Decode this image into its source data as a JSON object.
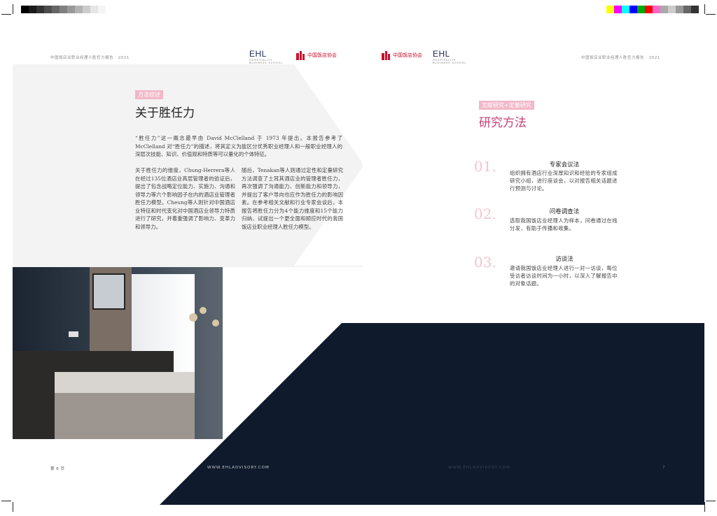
{
  "header": {
    "left_title": "中国饭店业职业经理人胜任力报告 · 2021",
    "right_title": "中国饭店业职业经理人胜任力报告 · 2021",
    "ehl_logo": "EHL",
    "ehl_sub": "HOSPITALITY BUSINESS SCHOOL",
    "association_logo": "中国饭店协会"
  },
  "left_page": {
    "tag": "方法综述",
    "title": "关于胜任力",
    "intro": "“胜任力”这一概念最早由 David McClelland 于 1973 年提出。本报告参考了 McClelland 对“胜任力”的描述，将其定义为能区分优秀职业经理人和一般职业经理人的深层次技能、知识、价值观和特质等可以量化的个体特征。",
    "col1": "关于胜任力的维度，Chung-Herrera等人在经过135位酒店业高层管理者的验证后，提出了包含战略定位能力、实施力、沟通和领导力等六个影响因子在内的酒店业管理者胜任力模型。Cheung等人则针对中国酒店业特征和时代变化对中国酒店业领导力特质进行了研究，并着重强调了影响力、变革力和领导力。",
    "col2": "随后，Tenakan等人则通过定性和定量研究方法调查了土耳其酒店业的管理者胜任力，再次强调了沟通能力、创新能力和领导力，并提出了客户导向也应作为胜任力的影响因素。在参考相关文献和行业专家会谈后，本报告将胜任力分为4个能力维度和15个能力归纳，试提出一个更全面和顺应时代的我国饭店业职业经理人胜任力模型。",
    "page_number": "第 6 页"
  },
  "right_page": {
    "tag": "文献研究+定量研究",
    "title": "研究方法",
    "methods": [
      {
        "number": "01.",
        "title": "专家会议法",
        "desc": "组织拥有酒店行业深厚知识和经验的专家组成研究小组，进行座谈会，以对报告相关话题进行预测与讨论。"
      },
      {
        "number": "02.",
        "title": "问卷调查法",
        "desc": "选取我国饭店业经理人为样本，问卷通过在线分发，有助于传播和收集。"
      },
      {
        "number": "03.",
        "title": "访谈法",
        "desc": "邀请我国饭店业经理人进行一对一访谈，每位受访者访谈时间为一小时，以深入了解报告中的对象话题。"
      }
    ],
    "page_number": "7"
  },
  "footer": {
    "left_url": "WWW.EHLADVISORY.COM",
    "right_url": "WWW.EHLADVISORY.COM"
  },
  "colors": {
    "navy": "#0f1b2d",
    "pink": "#f2b8c8",
    "accent_pink": "#c8427a",
    "light_gray": "#f3f3f4"
  },
  "color_bars": {
    "left": [
      "#000000",
      "#1a1a1a",
      "#333333",
      "#4d4d4d",
      "#666666",
      "#808080",
      "#999999",
      "#b3b3b3",
      "#cccccc",
      "#e6e6e6",
      "#f5f5f5"
    ],
    "right": [
      "#ffff00",
      "#ff00ff",
      "#00ffff",
      "#0000ff",
      "#00aa00",
      "#ff0000",
      "#ff66cc",
      "#aaaaaa",
      "#cccccc",
      "#999999",
      "#666666",
      "#333333"
    ]
  }
}
